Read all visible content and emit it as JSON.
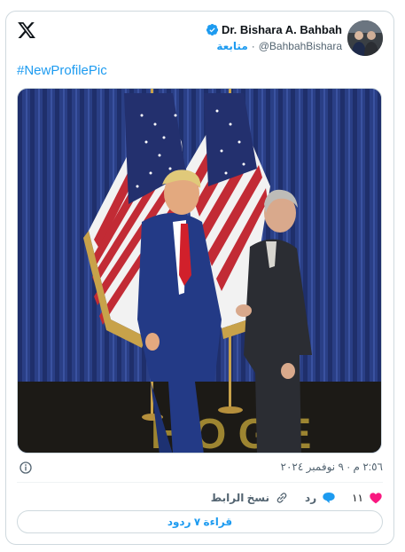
{
  "author": {
    "name": "Dr. Bishara A. Bahbah",
    "handle": "@BahbahBishara",
    "follow_label": "متابعة",
    "separator": "·"
  },
  "tweet": {
    "text": "#NewProfilePic",
    "timestamp": "٢:٥٦ م · ٩ نوفمبر ٢٠٢٤"
  },
  "actions": {
    "like_count": "١١",
    "reply_label": "رد",
    "copy_link_label": "نسخ الرابط"
  },
  "read_replies_label": "قراءة ٧ ردود",
  "colors": {
    "accent": "#1d9bf0",
    "like": "#f91880",
    "text_secondary": "#536471",
    "border": "#cfd9de"
  },
  "icons": [
    "x-logo-icon",
    "verified-badge-icon",
    "info-icon",
    "heart-icon",
    "reply-bubble-icon",
    "link-icon"
  ]
}
